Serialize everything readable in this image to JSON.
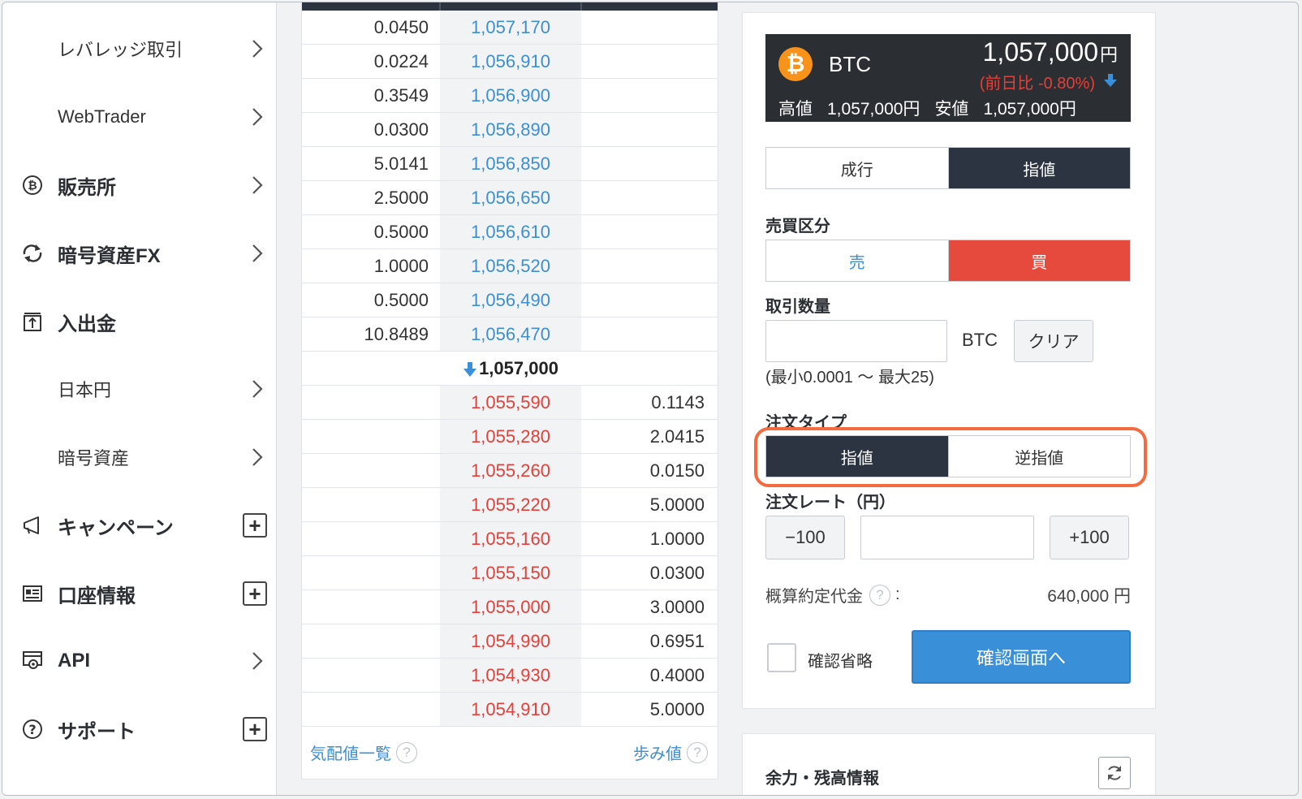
{
  "sidebar": {
    "items": [
      {
        "label": "レバレッジ取引",
        "control": "chevron"
      },
      {
        "label": "WebTrader",
        "control": "chevron"
      },
      {
        "label": "販売所",
        "icon": "bitcoin-circle-icon",
        "control": "chevron"
      },
      {
        "label": "暗号資産FX",
        "icon": "exchange-arrows-icon",
        "control": "chevron"
      },
      {
        "label": "入出金",
        "icon": "deposit-box-icon",
        "control": "none"
      },
      {
        "label": "日本円",
        "control": "chevron"
      },
      {
        "label": "暗号資産",
        "control": "chevron"
      },
      {
        "label": "キャンペーン",
        "icon": "megaphone-icon",
        "control": "plus"
      },
      {
        "label": "口座情報",
        "icon": "id-card-icon",
        "control": "plus"
      },
      {
        "label": "API",
        "icon": "api-gear-icon",
        "control": "chevron"
      },
      {
        "label": "サポート",
        "icon": "help-circle-icon",
        "control": "plus"
      }
    ]
  },
  "orderbook": {
    "asks": [
      {
        "qty": "0.0450",
        "price": "1,057,170"
      },
      {
        "qty": "0.0224",
        "price": "1,056,910"
      },
      {
        "qty": "0.3549",
        "price": "1,056,900"
      },
      {
        "qty": "0.0300",
        "price": "1,056,890"
      },
      {
        "qty": "5.0141",
        "price": "1,056,850"
      },
      {
        "qty": "2.5000",
        "price": "1,056,650"
      },
      {
        "qty": "0.5000",
        "price": "1,056,610"
      },
      {
        "qty": "1.0000",
        "price": "1,056,520"
      },
      {
        "qty": "0.5000",
        "price": "1,056,490"
      },
      {
        "qty": "10.8489",
        "price": "1,056,470"
      }
    ],
    "current_price": "1,057,000",
    "bids": [
      {
        "price": "1,055,590",
        "qty": "0.1143"
      },
      {
        "price": "1,055,280",
        "qty": "2.0415"
      },
      {
        "price": "1,055,260",
        "qty": "0.0150"
      },
      {
        "price": "1,055,220",
        "qty": "5.0000"
      },
      {
        "price": "1,055,160",
        "qty": "1.0000"
      },
      {
        "price": "1,055,150",
        "qty": "0.0300"
      },
      {
        "price": "1,055,000",
        "qty": "3.0000"
      },
      {
        "price": "1,054,990",
        "qty": "0.6951"
      },
      {
        "price": "1,054,930",
        "qty": "0.4000"
      },
      {
        "price": "1,054,910",
        "qty": "5.0000"
      }
    ],
    "footer_left": "気配値一覧",
    "footer_right": "歩み値",
    "help_glyph": "?"
  },
  "ticker": {
    "symbol": "BTC",
    "logo_glyph": "₿",
    "price": "1,057,000",
    "price_unit": "円",
    "change": "(前日比 -0.80%)",
    "high_label": "高値",
    "high_value": "1,057,000円",
    "low_label": "安値",
    "low_value": "1,057,000円"
  },
  "order": {
    "type_tabs": [
      "成行",
      "指値"
    ],
    "side_label": "売買区分",
    "sides": [
      "売",
      "買"
    ],
    "qty_label": "取引数量",
    "qty_unit": "BTC",
    "clear_button": "クリア",
    "qty_range": "(最小0.0001 〜 最大25)",
    "order_type_label": "注文タイプ",
    "order_types": [
      "指値",
      "逆指値"
    ],
    "rate_label": "注文レート（円）",
    "minus_button": "−100",
    "plus_button": "+100",
    "estimate_label": "概算約定代金",
    "estimate_colon": ":",
    "estimate_value": "640,000 円",
    "skip_confirm_label": "確認省略",
    "confirm_button": "確認画面へ"
  },
  "balance": {
    "title": "余力・残高情報"
  },
  "colors": {
    "dark_navy": "#2b3440",
    "ask_blue": "#3d8fd0",
    "bid_red": "#e0413a",
    "buy_red": "#e64a3c",
    "confirm_blue": "#3a8fd9",
    "highlight_orange": "#f36b3f",
    "bitcoin_orange": "#f7931a"
  }
}
